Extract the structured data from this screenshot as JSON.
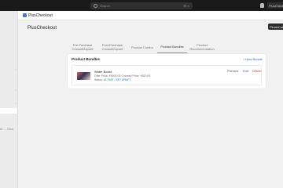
{
  "topbar": {
    "search_placeholder": "Search",
    "shortcut": "⌘ K",
    "store_label": "PlusCheckout"
  },
  "sidebar": {
    "truncated_text": "er ... Cha"
  },
  "app": {
    "name": "PlusCheckout"
  },
  "page": {
    "title": "PlusCheckout",
    "pin_button": "Pinned with"
  },
  "tabs": [
    {
      "label": "Pre-Purchase Crossell/Upsell"
    },
    {
      "label": "Post-Purchase Crossell/Upsell"
    },
    {
      "label": "Product Combo"
    },
    {
      "label": "Product Bundles"
    },
    {
      "label": "Product Recommendation"
    }
  ],
  "bundles": {
    "title": "Product Bundles",
    "new_button": "+ New Bundle",
    "items": [
      {
        "name": "Water Board",
        "price_line": "Offer Price: ₹5000.00 Crossed Price: ₹620.00",
        "status_label": "Status:",
        "status_active": "ACTIVE",
        "status_sep": "|",
        "status_draft": "SET DRAFT",
        "preview": "Preview",
        "edit": "Edit",
        "delete": "Delete"
      }
    ]
  },
  "colors": {
    "accent": "#2c6ecb",
    "active_tab_underline": "#7aa06a",
    "danger": "#d23b3b",
    "success": "#2a8a4a"
  }
}
